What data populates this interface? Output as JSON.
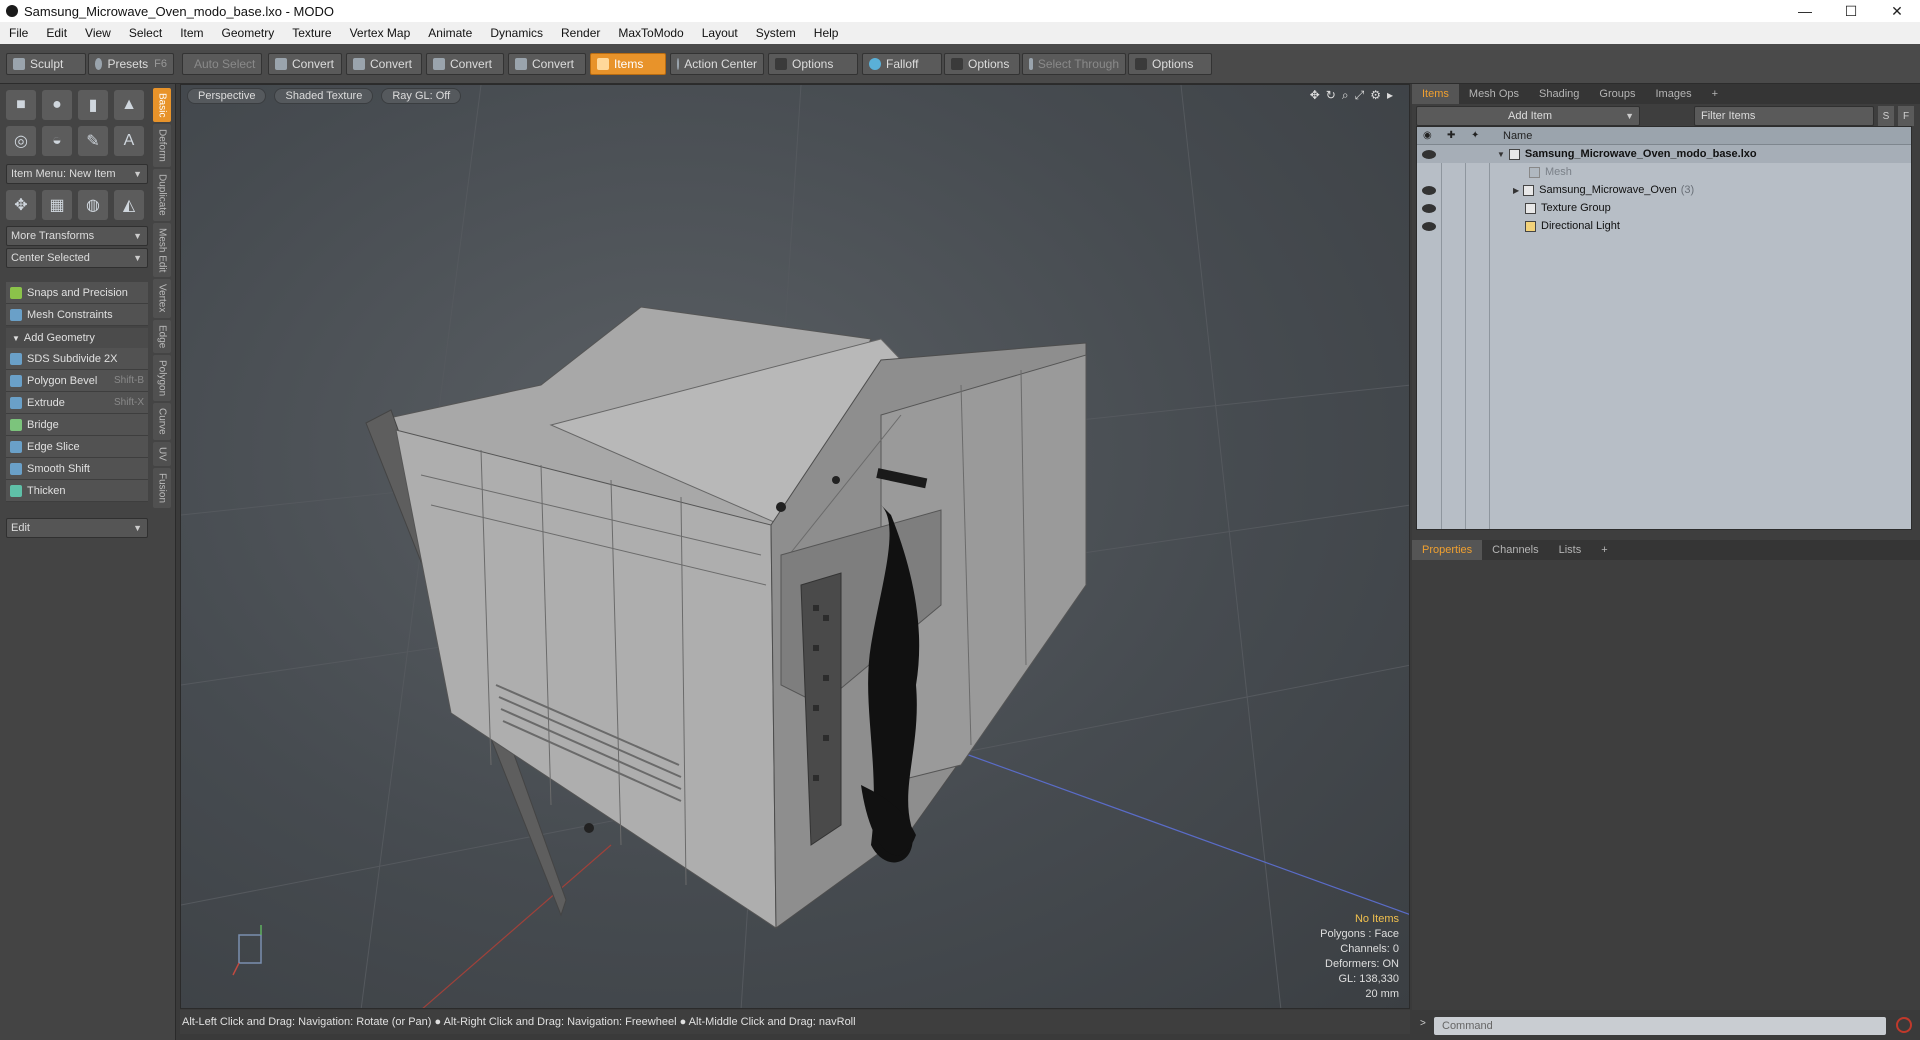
{
  "window": {
    "title": "Samsung_Microwave_Oven_modo_base.lxo - MODO",
    "minimize": "—",
    "maximize": "☐",
    "close": "✕"
  },
  "menu": [
    "File",
    "Edit",
    "View",
    "Select",
    "Item",
    "Geometry",
    "Texture",
    "Vertex Map",
    "Animate",
    "Dynamics",
    "Render",
    "MaxToModo",
    "Layout",
    "System",
    "Help"
  ],
  "toolbar": {
    "sculpt": "Sculpt",
    "presets": "Presets",
    "presets_key": "F6",
    "auto_select": "Auto Select",
    "convert1": "Convert",
    "convert2": "Convert",
    "convert3": "Convert",
    "convert4": "Convert",
    "items": "Items",
    "action_center": "Action Center",
    "options1": "Options",
    "falloff": "Falloff",
    "options2": "Options",
    "select_through": "Select Through",
    "options3": "Options"
  },
  "left": {
    "item_menu": "Item Menu: New Item",
    "more_transforms": "More Transforms",
    "center_selected": "Center Selected",
    "snaps": "Snaps and Precision",
    "mesh_constraints": "Mesh Constraints",
    "add_geometry": "Add Geometry",
    "tools": [
      {
        "label": "SDS Subdivide 2X",
        "key": ""
      },
      {
        "label": "Polygon Bevel",
        "key": "Shift-B"
      },
      {
        "label": "Extrude",
        "key": "Shift-X"
      },
      {
        "label": "Bridge",
        "key": ""
      },
      {
        "label": "Edge Slice",
        "key": ""
      },
      {
        "label": "Smooth Shift",
        "key": ""
      },
      {
        "label": "Thicken",
        "key": ""
      }
    ],
    "edit": "Edit",
    "vtabs": [
      "Basic",
      "Deform",
      "Duplicate",
      "Mesh Edit",
      "Vertex",
      "Edge",
      "Polygon",
      "Curve",
      "UV",
      "Fusion"
    ]
  },
  "viewport": {
    "view": "Perspective",
    "shading": "Shaded Texture",
    "raygl": "Ray GL: Off",
    "info": {
      "items": "No Items",
      "polygons": "Polygons : Face",
      "channels": "Channels: 0",
      "deformers": "Deformers: ON",
      "gl": "GL: 138,330",
      "scale": "20 mm"
    }
  },
  "status": "Alt-Left Click and Drag: Navigation: Rotate (or Pan) ● Alt-Right Click and Drag: Navigation: Freewheel ● Alt-Middle Click and Drag: navRoll",
  "right": {
    "tabs_top": [
      "Items",
      "Mesh Ops",
      "Shading",
      "Groups",
      "Images"
    ],
    "add_item": "Add Item",
    "filter_items": "Filter Items",
    "s": "S",
    "f": "F",
    "col_name": "Name",
    "tree": [
      {
        "label": "Samsung_Microwave_Oven_modo_base.lxo",
        "count": ""
      },
      {
        "label": "Mesh",
        "count": ""
      },
      {
        "label": "Samsung_Microwave_Oven",
        "count": "(3)"
      },
      {
        "label": "Texture Group",
        "count": ""
      },
      {
        "label": "Directional Light",
        "count": ""
      }
    ],
    "tabs_bottom": [
      "Properties",
      "Channels",
      "Lists"
    ],
    "command": "Command"
  }
}
